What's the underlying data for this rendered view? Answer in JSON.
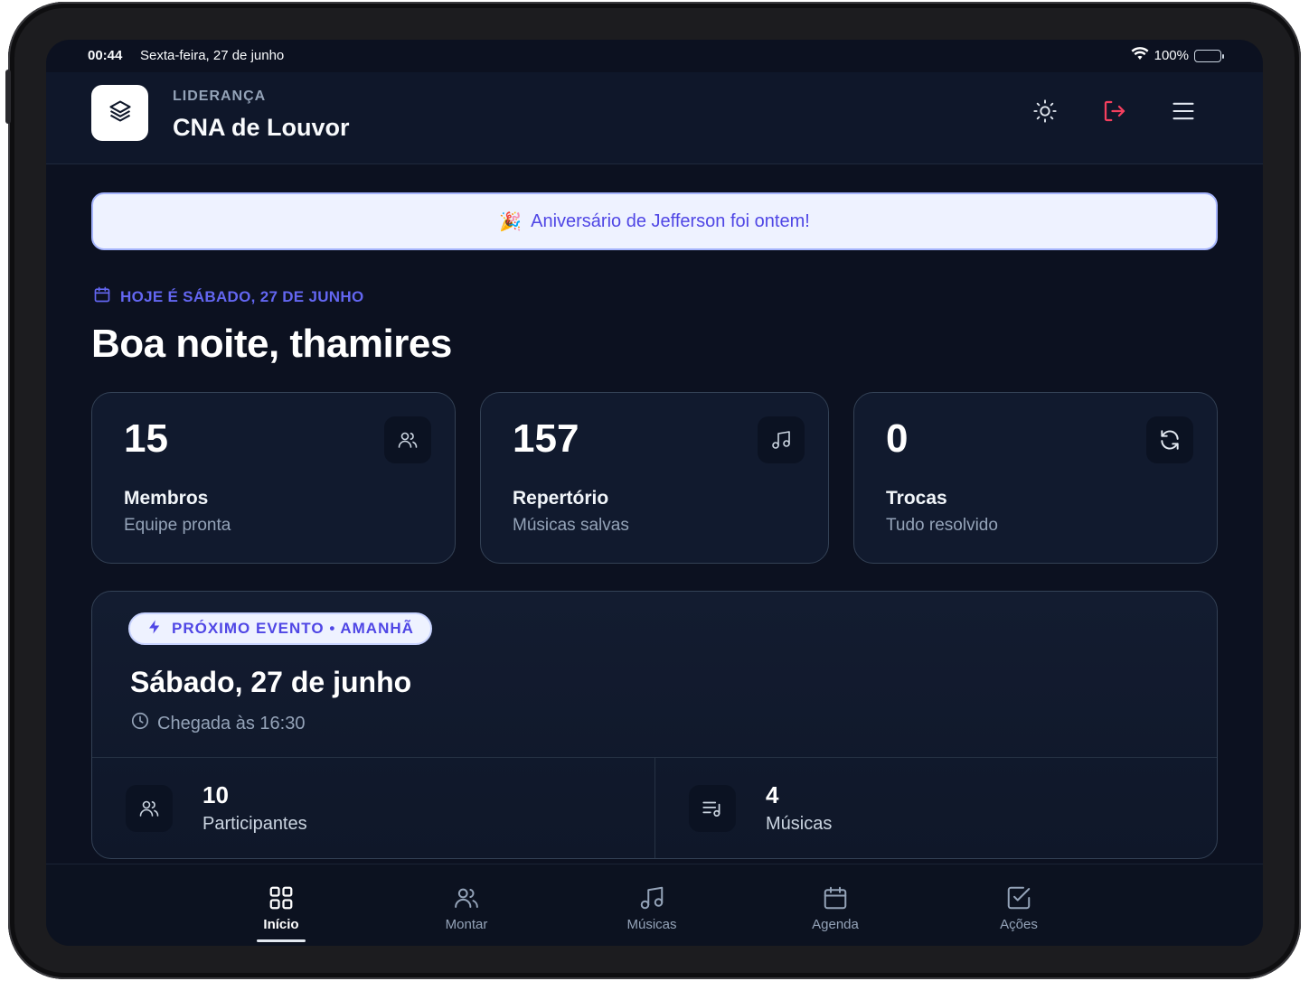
{
  "status_bar": {
    "time": "00:44",
    "date": "Sexta-feira, 27 de junho",
    "battery": "100%"
  },
  "header": {
    "eyebrow": "LIDERANÇA",
    "title": "CNA de Louvor",
    "logo_icon": "layers-icon",
    "icons": [
      "sun-icon",
      "logout-icon",
      "menu-icon"
    ]
  },
  "banner": {
    "emoji": "🎉",
    "text": "Aniversário de Jefferson foi ontem!"
  },
  "today": {
    "label": "HOJE É SÁBADO, 27 DE JUNHO",
    "greeting": "Boa noite, thamires"
  },
  "stats": [
    {
      "value": "15",
      "label": "Membros",
      "sub": "Equipe pronta",
      "icon": "users-icon"
    },
    {
      "value": "157",
      "label": "Repertório",
      "sub": "Músicas salvas",
      "icon": "music-icon"
    },
    {
      "value": "0",
      "label": "Trocas",
      "sub": "Tudo resolvido",
      "icon": "refresh-icon"
    }
  ],
  "event": {
    "pill": "PRÓXIMO EVENTO • AMANHÃ",
    "date": "Sábado, 27 de junho",
    "arrival": "Chegada às 16:30",
    "participants_count": "10",
    "participants_label": "Participantes",
    "songs_count": "4",
    "songs_label": "Músicas"
  },
  "nav": [
    {
      "label": "Início",
      "icon": "grid-icon",
      "active": true
    },
    {
      "label": "Montar",
      "icon": "users-icon",
      "active": false
    },
    {
      "label": "Músicas",
      "icon": "music-icon",
      "active": false
    },
    {
      "label": "Agenda",
      "icon": "calendar-icon",
      "active": false
    },
    {
      "label": "Ações",
      "icon": "checkbox-icon",
      "active": false
    }
  ],
  "colors": {
    "background": "#0c1120",
    "accent": "#6366f1",
    "logout": "#f43f5e",
    "muted": "#94a3b8"
  }
}
